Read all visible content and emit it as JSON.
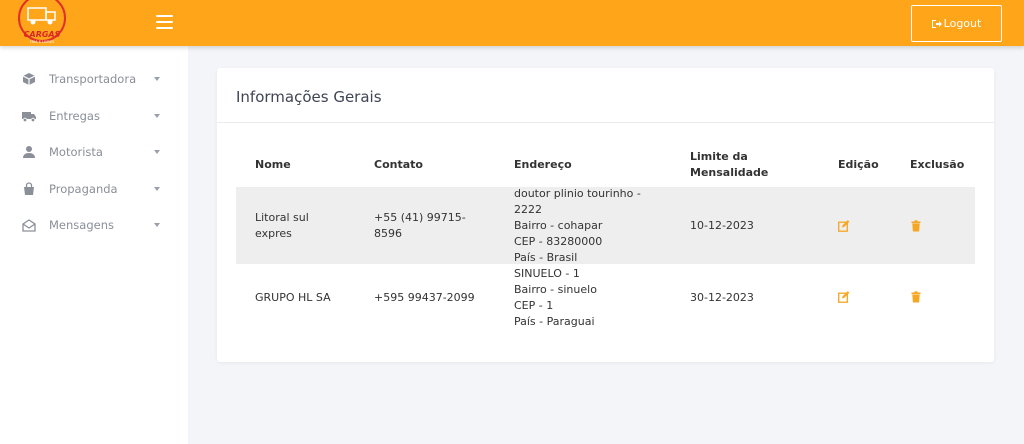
{
  "header": {
    "logo_text": "CARGAS",
    "logo_subtext": "FRIA E LIVRES",
    "logout_label": "Logout",
    "accent_color": "#ffa51a"
  },
  "sidebar": {
    "items": [
      {
        "label": "Transportadora",
        "icon": "box-icon"
      },
      {
        "label": "Entregas",
        "icon": "truck-icon"
      },
      {
        "label": "Motorista",
        "icon": "user-icon"
      },
      {
        "label": "Propaganda",
        "icon": "bag-icon"
      },
      {
        "label": "Mensagens",
        "icon": "envelope-icon"
      }
    ]
  },
  "main": {
    "title": "Informações Gerais",
    "table": {
      "headers": {
        "nome": "Nome",
        "contato": "Contato",
        "endereco": "Endereço",
        "limite_1": "Limite da",
        "limite_2": "Mensalidade",
        "edicao": "Edição",
        "exclusao": "Exclusão"
      },
      "rows": [
        {
          "nome_1": "Litoral sul",
          "nome_2": "expres",
          "contato_1": "+55 (41) 99715-",
          "contato_2": "8596",
          "endereco_1": "doutor plinio tourinho -",
          "endereco_2": "2222",
          "endereco_3": "Bairro - cohapar",
          "endereco_4": "CEP - 83280000",
          "endereco_5": "País - Brasil",
          "limite": "10-12-2023"
        },
        {
          "nome_1": "GRUPO HL SA",
          "contato_1": "+595 99437-2099",
          "endereco_1": "SINUELO - 1",
          "endereco_2": "Bairro - sinuelo",
          "endereco_3": "CEP - 1",
          "endereco_4": "País - Paraguai",
          "limite": "30-12-2023"
        }
      ]
    }
  }
}
